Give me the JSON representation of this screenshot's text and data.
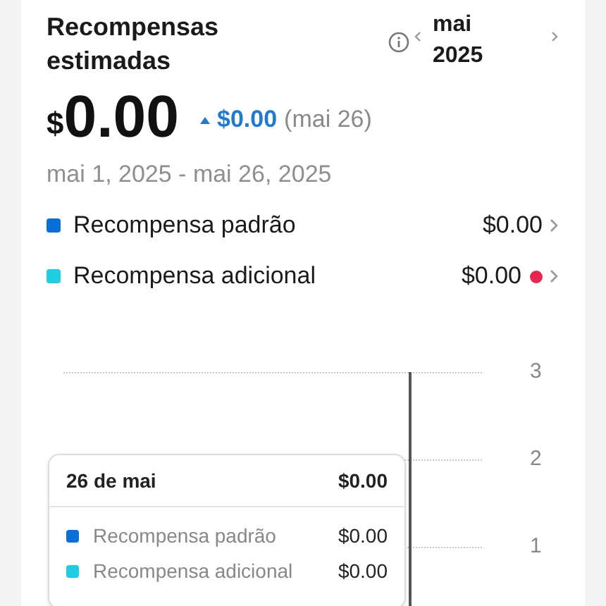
{
  "header": {
    "title": "Recompensas estimadas",
    "period": "mai 2025"
  },
  "total": {
    "currency": "$",
    "value": "0.00",
    "change": "$0.00",
    "change_date": "(mai 26)"
  },
  "date_range": "mai 1, 2025 - mai 26, 2025",
  "legend": [
    {
      "label": "Recompensa padrão",
      "value": "$0.00",
      "color": "#0a6fd6",
      "alert": false
    },
    {
      "label": "Recompensa adicional",
      "value": "$0.00",
      "color": "#1fcde0",
      "alert": true
    }
  ],
  "chart": {
    "y_ticks": [
      "3",
      "2",
      "1"
    ],
    "tooltip": {
      "date": "26 de mai",
      "total": "$0.00",
      "rows": [
        {
          "label": "Recompensa padrão",
          "value": "$0.00",
          "color": "#0a6fd6"
        },
        {
          "label": "Recompensa adicional",
          "value": "$0.00",
          "color": "#1fcde0"
        }
      ]
    }
  }
}
